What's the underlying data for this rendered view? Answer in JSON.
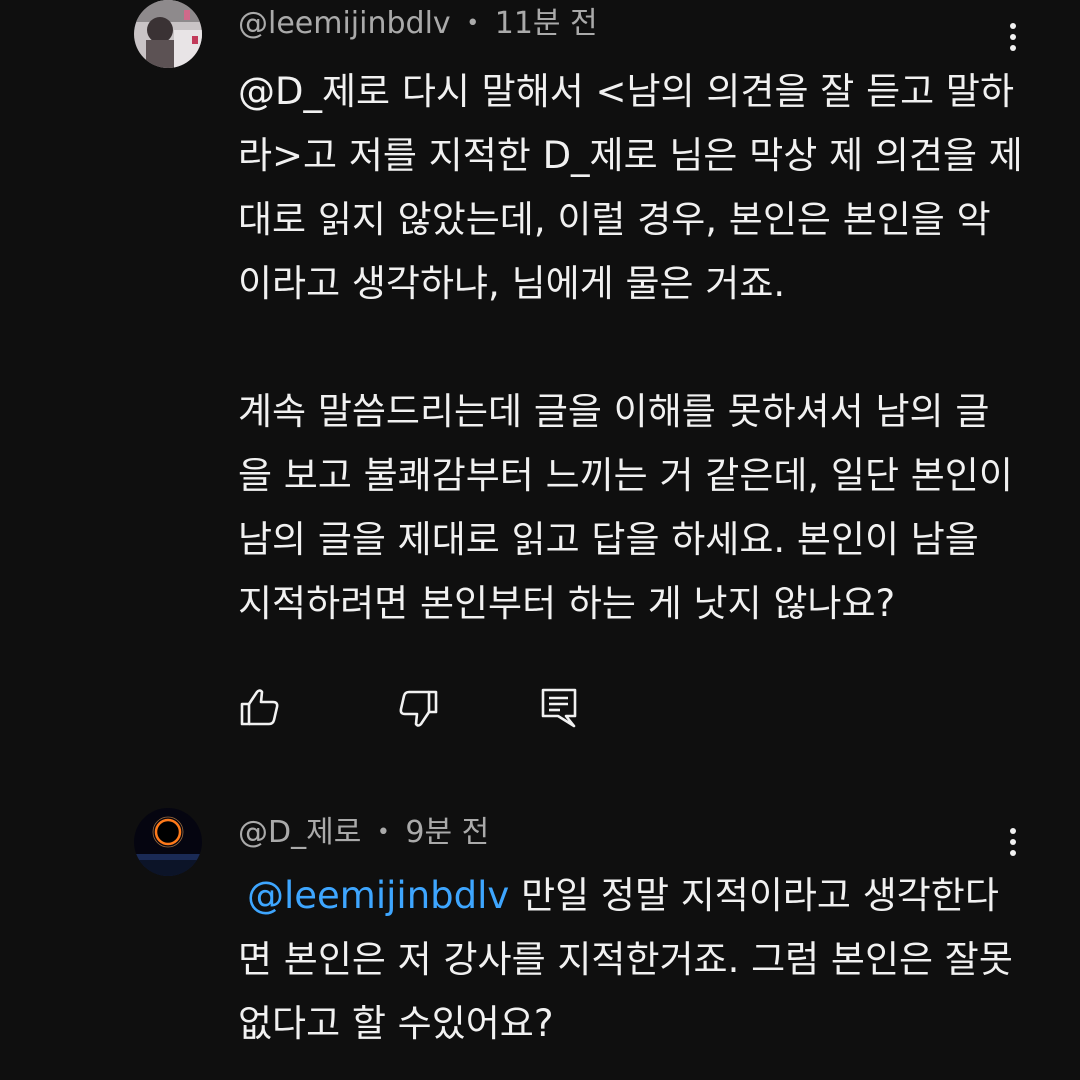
{
  "comments": [
    {
      "author": "@leemijinbdlv",
      "separator": "•",
      "time": "11분 전",
      "lines": [
        "@D_제로 다시 말해서 <남의 의견을 잘 듣고 말하",
        "라>고 저를 지적한 D_제로 님은 막상 제 의견을 제",
        "대로 읽지 않았는데, 이럴 경우, 본인은 본인을 악",
        "이라고 생각하냐, 님에게 물은 거죠.",
        "",
        "계속 말씀드리는데 글을 이해를 못하셔서 남의 글",
        "을 보고 불쾌감부터 느끼는 거 같은데, 일단 본인이",
        "남의 글을 제대로 읽고 답을 하세요. 본인이 남을",
        "지적하려면 본인부터 하는 게 낫지 않나요?"
      ],
      "actions": {
        "like_icon": "thumbs-up-icon",
        "dislike_icon": "thumbs-down-icon",
        "reply_icon": "comment-reply-icon"
      },
      "menu_icon": "more-vert-icon"
    },
    {
      "author": "@D_제로",
      "separator": "•",
      "time": "9분 전",
      "mention": "@leemijinbdlv",
      "first_line_rest": "만일 정말 지적이라고 생각한다",
      "lines": [
        "면 본인은 저 강사를 지적한거죠. 그럼 본인은 잘못",
        "없다고 할 수있어요?"
      ],
      "menu_icon": "more-vert-icon"
    }
  ],
  "colors": {
    "background": "#0f0f0f",
    "text": "#f1f1f1",
    "meta": "#aaaaaa",
    "mention": "#3ea6ff"
  }
}
